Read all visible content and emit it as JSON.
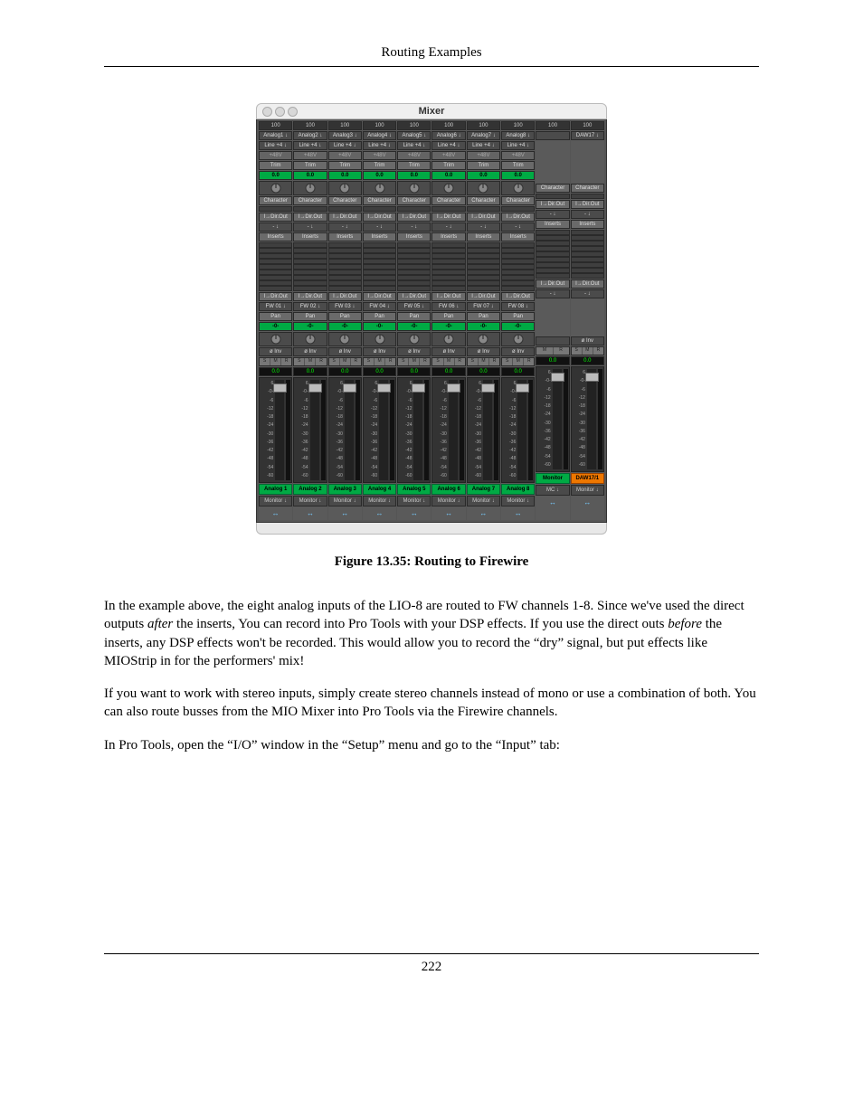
{
  "running_head": "Routing Examples",
  "caption": "Figure 13.35: Routing to Firewire",
  "page_number": "222",
  "body": {
    "p1a": "In the example above, the eight analog inputs of the LIO-8 are routed to FW channels 1-8. Since we've used the direct outputs ",
    "p1i1": "after",
    "p1b": " the inserts, You can record into Pro Tools with your DSP effects. If you use the direct outs ",
    "p1i2": "before",
    "p1c": " the inserts, any DSP effects won't be recorded. This would allow you to record the “dry” signal, but put effects like MIOStrip in for the performers' mix!",
    "p2": "If you want to work with stereo inputs, simply create stereo channels instead of mono or use a combination of both. You can also route busses from the MIO Mixer into Pro Tools via the Firewire channels.",
    "p3": "In Pro Tools, open the “I/O” window in the “Setup” menu and go to the “Input” tab:"
  },
  "mixer": {
    "title": "Mixer",
    "labels": {
      "trim": "Trim",
      "character": "Character",
      "dirout": "I→Dir.Out",
      "inserts": "Inserts",
      "pan": "Pan",
      "pan_value": "-0-",
      "inv": "ø Inv",
      "v48": "+48V",
      "zero": "0.0",
      "stereo": "↔"
    },
    "fader_ticks": [
      "6",
      "-0-",
      "-6",
      "-12",
      "-18",
      "-24",
      "-30",
      "-36",
      "-42",
      "-48",
      "-54",
      "-60"
    ],
    "strips": [
      {
        "hundred": "100",
        "src": "Analog1 ↓",
        "line": "Line +4 ↓",
        "fw": "FW 01 ↓",
        "name": "Analog 1",
        "name_style": "green",
        "out": "Monitor ↓",
        "full": true,
        "smr": [
          "S",
          "M",
          "R"
        ]
      },
      {
        "hundred": "100",
        "src": "Analog2 ↓",
        "line": "Line +4 ↓",
        "fw": "FW 02 ↓",
        "name": "Analog 2",
        "name_style": "green",
        "out": "Monitor ↓",
        "full": true,
        "smr": [
          "S",
          "M",
          "R"
        ]
      },
      {
        "hundred": "100",
        "src": "Analog3 ↓",
        "line": "Line +4 ↓",
        "fw": "FW 03 ↓",
        "name": "Analog 3",
        "name_style": "green",
        "out": "Monitor ↓",
        "full": true,
        "smr": [
          "S",
          "M",
          "R"
        ]
      },
      {
        "hundred": "100",
        "src": "Analog4 ↓",
        "line": "Line +4 ↓",
        "fw": "FW 04 ↓",
        "name": "Analog 4",
        "name_style": "green",
        "out": "Monitor ↓",
        "full": true,
        "smr": [
          "S",
          "M",
          "R"
        ]
      },
      {
        "hundred": "100",
        "src": "Analog5 ↓",
        "line": "Line +4 ↓",
        "fw": "FW 05 ↓",
        "name": "Analog 5",
        "name_style": "green",
        "out": "Monitor ↓",
        "full": true,
        "smr": [
          "S",
          "M",
          "R"
        ]
      },
      {
        "hundred": "100",
        "src": "Analog6 ↓",
        "line": "Line +4 ↓",
        "fw": "FW 06 ↓",
        "name": "Analog 6",
        "name_style": "green",
        "out": "Monitor ↓",
        "full": true,
        "smr": [
          "S",
          "M",
          "R"
        ]
      },
      {
        "hundred": "100",
        "src": "Analog7 ↓",
        "line": "Line +4 ↓",
        "fw": "FW 07 ↓",
        "name": "Analog 7",
        "name_style": "green",
        "out": "Monitor ↓",
        "full": true,
        "smr": [
          "S",
          "M",
          "R"
        ]
      },
      {
        "hundred": "100",
        "src": "Analog8 ↓",
        "line": "Line +4 ↓",
        "fw": "FW 08 ↓",
        "name": "Analog 8",
        "name_style": "green",
        "out": "Monitor ↓",
        "full": true,
        "smr": [
          "S",
          "M",
          "R"
        ]
      },
      {
        "hundred": "100",
        "src": "",
        "line": "",
        "fw": "- ↓",
        "name": "Monitor",
        "name_style": "green",
        "out": "MC  ↓",
        "full": false,
        "smr": [
          "M",
          "R"
        ]
      },
      {
        "hundred": "100",
        "src": "DAW17 ↓",
        "line": "",
        "fw": "- ↓",
        "name": "DAW17/1",
        "name_style": "orange",
        "out": "Monitor ↓",
        "full": false,
        "smr": [
          "S",
          "M",
          "R"
        ]
      }
    ]
  }
}
